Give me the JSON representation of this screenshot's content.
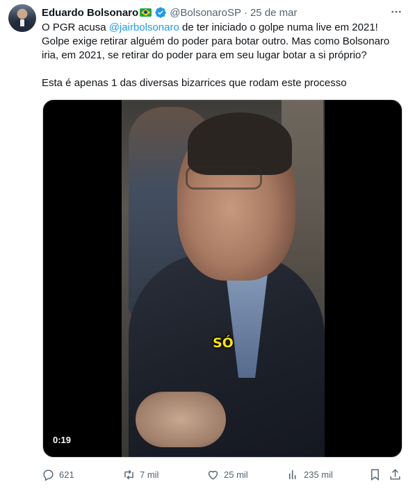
{
  "tweet": {
    "author_name": "Eduardo Bolsonaro",
    "handle": "@BolsonaroSP",
    "separator": "·",
    "date": "25 de mar",
    "line1_before": "O PGR acusa ",
    "mention": "@jairbolsonaro",
    "line1_after": " de ter iniciado o golpe numa live em 2021!",
    "line2": "Golpe exige retirar alguém do poder para botar outro. Mas como Bolsonaro iria, em 2021, se retirar do poder para em seu lugar botar a si próprio?",
    "line3": "Esta é apenas 1 das diversas bizarrices que rodam este processo"
  },
  "video": {
    "caption": "SÓ",
    "timecode": "0:19"
  },
  "actions": {
    "replies": "621",
    "retweets": "7 mil",
    "likes": "25 mil",
    "views": "235 mil"
  },
  "colors": {
    "accent": "#1d9bf0",
    "secondary_text": "#536471",
    "caption": "#ffe600"
  },
  "icons": [
    "brazil-flag-icon",
    "verified-badge-icon",
    "more-icon",
    "reply-icon",
    "retweet-icon",
    "like-icon",
    "views-icon",
    "bookmark-icon",
    "share-icon"
  ]
}
